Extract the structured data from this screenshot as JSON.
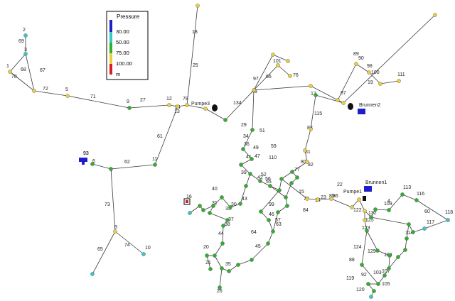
{
  "legend": {
    "title": "Pressure",
    "unit": "m",
    "entries": [
      {
        "label": "30.00",
        "color": "#1e1ec8"
      },
      {
        "label": "50.00",
        "color": "#38c8c8"
      },
      {
        "label": "75.00",
        "color": "#30b030"
      },
      {
        "label": "100.00",
        "color": "#e8d040"
      },
      {
        "label": "",
        "color": "#d82020"
      }
    ]
  },
  "colors": {
    "pipe": "#3a3a3a",
    "node_green": "#30b030",
    "node_yellow": "#e8d040",
    "node_cyan": "#38c8c8",
    "tank_blue": "#1e1ec8",
    "reservoir_red": "#d82020",
    "pump_black": "#111111"
  },
  "labels": {
    "pumps": [
      "Pumpe1",
      "Pumpe3"
    ],
    "reservoirs": [
      "Brunnen1",
      "Brunnen2"
    ],
    "tank": "93",
    "pipe_ids": [
      "1",
      "2",
      "3",
      "4",
      "5",
      "6",
      "7",
      "8",
      "9",
      "10",
      "11",
      "12",
      "13",
      "14",
      "15",
      "16",
      "17",
      "18",
      "19",
      "20",
      "21",
      "22",
      "23",
      "24",
      "25",
      "26",
      "27",
      "29",
      "30",
      "31",
      "33",
      "34",
      "35",
      "36",
      "37",
      "38",
      "39",
      "40",
      "41",
      "42",
      "43",
      "44",
      "45",
      "46",
      "47",
      "48",
      "49",
      "51",
      "52",
      "55",
      "56",
      "57",
      "59",
      "60",
      "61",
      "62",
      "63",
      "64",
      "65",
      "66",
      "67",
      "68",
      "69",
      "70",
      "71",
      "72",
      "73",
      "74",
      "76",
      "77",
      "78",
      "79",
      "80",
      "81",
      "82",
      "83",
      "84",
      "85",
      "86",
      "87",
      "88",
      "89",
      "90",
      "92",
      "93",
      "97",
      "98",
      "99",
      "100",
      "101",
      "103",
      "105",
      "107",
      "108",
      "109",
      "110",
      "111",
      "113",
      "114",
      "115",
      "116",
      "117",
      "118",
      "119",
      "120",
      "122",
      "123",
      "124",
      "125",
      "129",
      "132",
      "134"
    ]
  }
}
